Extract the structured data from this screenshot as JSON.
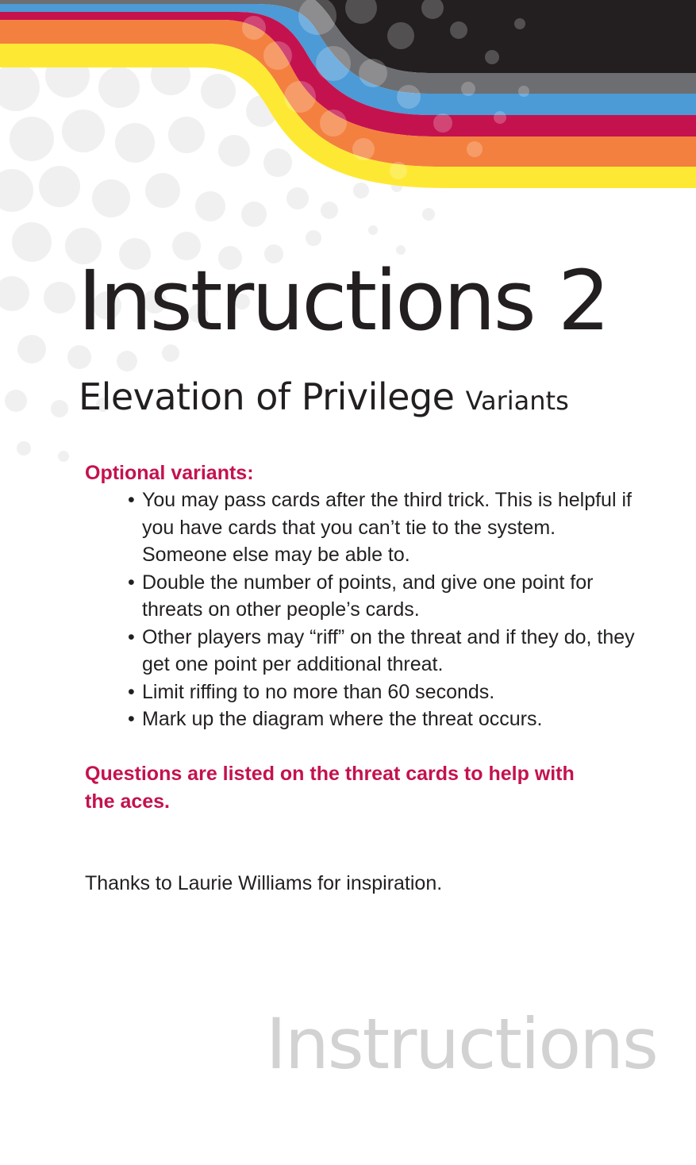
{
  "card": {
    "title": "Instructions 2",
    "subtitle": "Elevation of Privilege",
    "subtitle_suffix": "Variants",
    "section_heading": "Optional variants:",
    "variants": [
      "You may pass cards after the third trick. This is helpful if you have cards that you can’t tie to the system. Someone else may be able to.",
      "Double the number of points, and give one point for threats on other people’s cards.",
      "Other players may “riff” on the threat and if they do, they get one point per additional threat.",
      "Limit riffing to no more than 60 seconds.",
      "Mark up the diagram where the threat occurs."
    ],
    "note": "Questions are listed on the threat cards to help with the aces.",
    "thanks": "Thanks to Laurie Williams for inspiration.",
    "watermark": "Instructions"
  },
  "colors": {
    "accent": "#c4124f",
    "text": "#231f20",
    "stripe_black": "#231f20",
    "stripe_gray": "#6d6e71",
    "stripe_blue": "#4c9ad6",
    "stripe_magenta": "#c4124f",
    "stripe_orange": "#f4803f",
    "stripe_yellow": "#fde933",
    "watermark": "#d2d2d2"
  }
}
